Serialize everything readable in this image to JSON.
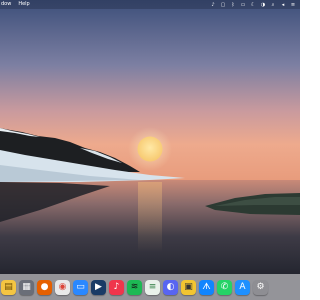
{
  "menubar": {
    "left_items": [
      "dow",
      "Help"
    ],
    "right_icons": [
      "apple-music-icon",
      "lock-icon",
      "bluetooth-icon",
      "screen-icon",
      "clock-icon",
      "control-center-icon",
      "search-icon",
      "volume-icon",
      "menu-icon"
    ]
  },
  "dock": {
    "apps": [
      {
        "name": "notes-app-icon",
        "color": "#f4c542",
        "glyph": "▤"
      },
      {
        "name": "launchpad-app-icon",
        "color": "#6a6e78",
        "glyph": "▦"
      },
      {
        "name": "firefox-app-icon",
        "color": "#e66000",
        "glyph": "●"
      },
      {
        "name": "chrome-app-icon",
        "color": "#e9e9e9",
        "glyph": "◉"
      },
      {
        "name": "messages-app-icon",
        "color": "#2a88ff",
        "glyph": "▭"
      },
      {
        "name": "prime-video-app-icon",
        "color": "#1a3b66",
        "glyph": "▶"
      },
      {
        "name": "music-app-icon",
        "color": "#f0354c",
        "glyph": "♪"
      },
      {
        "name": "spotify-app-icon",
        "color": "#1db954",
        "glyph": "≋"
      },
      {
        "name": "sublime-app-icon",
        "color": "#e9f1ea",
        "glyph": "≡"
      },
      {
        "name": "discord-app-icon",
        "color": "#5865f2",
        "glyph": "◐"
      },
      {
        "name": "game-app-icon",
        "color": "#f2c531",
        "glyph": "▣"
      },
      {
        "name": "bluesky-app-icon",
        "color": "#1185fe",
        "glyph": "ᗑ"
      },
      {
        "name": "whatsapp-app-icon",
        "color": "#25d366",
        "glyph": "✆"
      },
      {
        "name": "app-store-app-icon",
        "color": "#1e90ff",
        "glyph": "A"
      },
      {
        "name": "system-settings-app-icon",
        "color": "#8e8e93",
        "glyph": "⚙"
      }
    ]
  }
}
